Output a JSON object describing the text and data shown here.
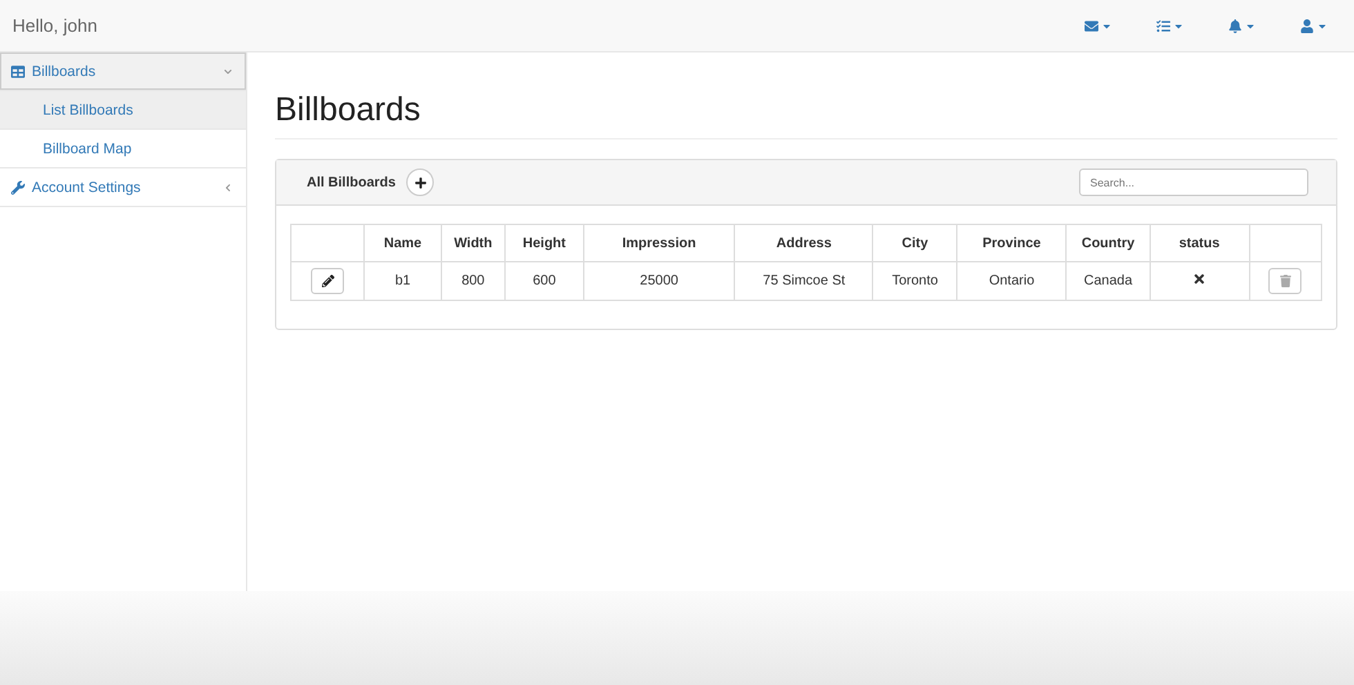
{
  "navbar": {
    "greeting": "Hello, john",
    "menus": [
      {
        "kind": "mail"
      },
      {
        "kind": "tasks"
      },
      {
        "kind": "alerts"
      },
      {
        "kind": "user"
      }
    ]
  },
  "sidebar": {
    "items": [
      {
        "label": "Billboards",
        "expanded": true,
        "children": [
          {
            "label": "List Billboards",
            "selected": true
          },
          {
            "label": "Billboard Map",
            "selected": false
          }
        ]
      },
      {
        "label": "Account Settings",
        "expanded": false
      }
    ]
  },
  "page": {
    "title": "Billboards"
  },
  "panel": {
    "title": "All Billboards",
    "search": {
      "placeholder": "Search..."
    },
    "table": {
      "columns": [
        "",
        "Name",
        "Width",
        "Height",
        "Impression",
        "Address",
        "City",
        "Province",
        "Country",
        "status",
        ""
      ],
      "rows": [
        {
          "cells": [
            "",
            "b1",
            "800",
            "600",
            "25000",
            "75 Simcoe St",
            "Toronto",
            "Ontario",
            "Canada"
          ],
          "status": false
        }
      ]
    }
  }
}
